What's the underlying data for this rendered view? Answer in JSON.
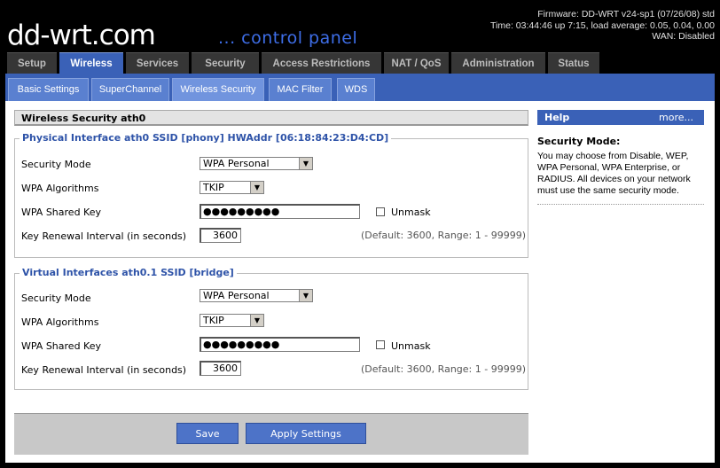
{
  "header": {
    "logo_main": "dd-wrt",
    "logo_dotcom": ".com",
    "logo_tagline": "... control panel",
    "firmware": "Firmware: DD-WRT v24-sp1 (07/26/08) std",
    "time": "Time: 03:44:46 up 7:15, load average: 0.05, 0.04, 0.00",
    "wan": "WAN: Disabled"
  },
  "main_tabs": [
    "Setup",
    "Wireless",
    "Services",
    "Security",
    "Access Restrictions",
    "NAT / QoS",
    "Administration",
    "Status"
  ],
  "sub_tabs": [
    "Basic Settings",
    "SuperChannel",
    "Wireless Security",
    "MAC Filter",
    "WDS"
  ],
  "section_title": "Wireless Security ath0",
  "physical": {
    "legend": "Physical Interface ath0 SSID [phony] HWAddr [06:18:84:23:D4:CD]",
    "security_mode_label": "Security Mode",
    "security_mode_value": "WPA Personal",
    "algorithms_label": "WPA Algorithms",
    "algorithms_value": "TKIP",
    "shared_key_label": "WPA Shared Key",
    "shared_key_value": "●●●●●●●●●",
    "unmask_label": "Unmask",
    "renewal_label": "Key Renewal Interval (in seconds)",
    "renewal_value": "3600",
    "renewal_hint": "(Default: 3600, Range: 1 - 99999)"
  },
  "virtual": {
    "legend": "Virtual Interfaces ath0.1 SSID [bridge]",
    "security_mode_label": "Security Mode",
    "security_mode_value": "WPA Personal",
    "algorithms_label": "WPA Algorithms",
    "algorithms_value": "TKIP",
    "shared_key_label": "WPA Shared Key",
    "shared_key_value": "●●●●●●●●●",
    "unmask_label": "Unmask",
    "renewal_label": "Key Renewal Interval (in seconds)",
    "renewal_value": "3600",
    "renewal_hint": "(Default: 3600, Range: 1 - 99999)"
  },
  "buttons": {
    "save": "Save",
    "apply": "Apply Settings"
  },
  "help": {
    "title": "Help",
    "more": "more...",
    "topic": "Security Mode:",
    "body": "You may choose from Disable, WEP, WPA Personal, WPA Enterprise, or RADIUS. All devices on your network must use the same security mode."
  },
  "colors": {
    "accent_blue": "#3a61b7",
    "tab_dark": "#363636",
    "legend_blue": "#2e53a8"
  },
  "icons": {
    "dropdown": "dropdown-arrow-icon"
  }
}
